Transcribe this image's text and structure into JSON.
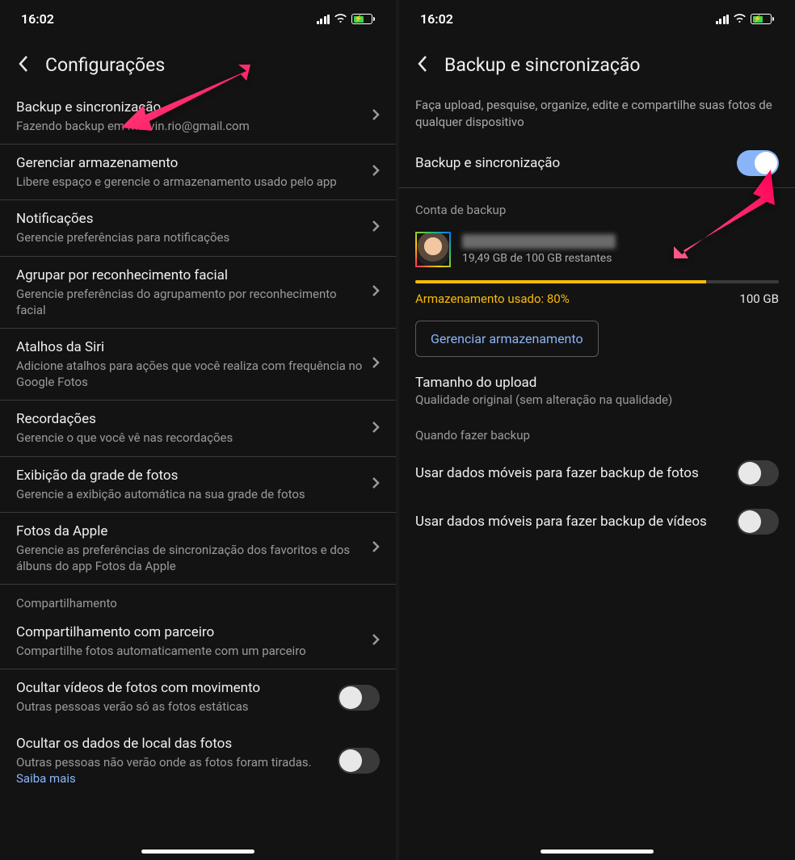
{
  "status": {
    "time": "16:02"
  },
  "left": {
    "header_title": "Configurações",
    "items": [
      {
        "title": "Backup e sincronização",
        "sub": "Fazendo backup em marvin.rio@gmail.com"
      },
      {
        "title": "Gerenciar armazenamento",
        "sub": "Libere espaço e gerencie o armazenamento usado pelo app"
      },
      {
        "title": "Notificações",
        "sub": "Gerencie preferências para notificações"
      },
      {
        "title": "Agrupar por reconhecimento facial",
        "sub": "Gerencie preferências do agrupamento por reconhecimento facial"
      },
      {
        "title": "Atalhos da Siri",
        "sub": "Adicione atalhos para ações que você realiza com frequência no Google Fotos"
      },
      {
        "title": "Recordações",
        "sub": "Gerencie o que você vê nas recordações"
      },
      {
        "title": "Exibição da grade de fotos",
        "sub": "Gerencie a exibição automática na sua grade de fotos"
      },
      {
        "title": "Fotos da Apple",
        "sub": "Gerencie as preferências de sincronização dos favoritos e dos álbuns do app Fotos da Apple"
      }
    ],
    "section_share": "Compartilhamento",
    "share_item": {
      "title": "Compartilhamento com parceiro",
      "sub": "Compartilhe fotos automaticamente com um parceiro"
    },
    "hide_video": {
      "title": "Ocultar vídeos de fotos com movimento",
      "sub": "Outras pessoas verão só as fotos estáticas"
    },
    "hide_location": {
      "title": "Ocultar os dados de local das fotos",
      "sub_prefix": "Outras pessoas não verão onde as fotos foram tiradas. ",
      "link": "Saiba mais"
    }
  },
  "right": {
    "header_title": "Backup e sincronização",
    "desc": "Faça upload, pesquise, organize, edite e compartilhe suas fotos de qualquer dispositivo",
    "toggle_label": "Backup e sincronização",
    "account_section": "Conta de backup",
    "account_storage_sub": "19,49 GB de 100 GB restantes",
    "storage_used_label": "Armazenamento usado: 80%",
    "storage_total": "100 GB",
    "storage_percent": 80,
    "manage_btn": "Gerenciar armazenamento",
    "upload": {
      "title": "Tamanho do upload",
      "sub": "Qualidade original (sem alteração na qualidade)"
    },
    "when_section": "Quando fazer backup",
    "opt_photos": "Usar dados móveis para fazer backup de fotos",
    "opt_videos": "Usar dados móveis para fazer backup de vídeos"
  },
  "colors": {
    "accent_blue": "#8ab4f8",
    "accent_yellow": "#fbbc04",
    "pink": "#ff2d75"
  }
}
